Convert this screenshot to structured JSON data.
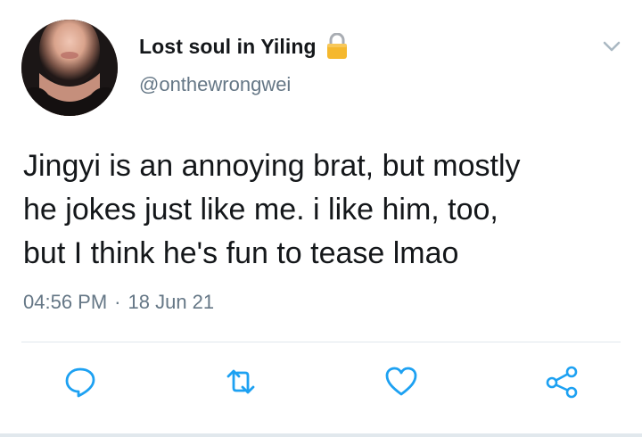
{
  "user": {
    "display_name": "Lost soul in Yiling",
    "handle": "@onthewrongwei",
    "protected_icon": "lock-icon",
    "avatar": "avatar-photo"
  },
  "tweet": {
    "text": "Jingyi is an annoying brat, but mostly\nhe jokes just like me. i like him, too,\nbut I think he's fun to tease lmao",
    "time": "04:56 PM",
    "separator": "·",
    "date": "18 Jun 21"
  },
  "actions": [
    {
      "name": "reply",
      "icon": "reply-icon"
    },
    {
      "name": "retweet",
      "icon": "retweet-icon"
    },
    {
      "name": "like",
      "icon": "heart-icon"
    },
    {
      "name": "share",
      "icon": "share-icon"
    }
  ],
  "colors": {
    "text": "#14171a",
    "secondary": "#657786",
    "icon": "#1da1f2",
    "lock": "#f5b82e",
    "divider": "#e1e8ed"
  }
}
